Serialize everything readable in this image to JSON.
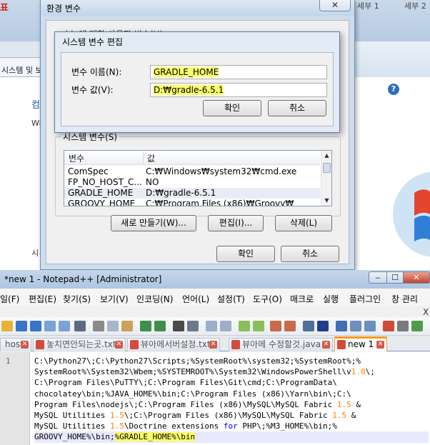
{
  "background": {
    "brand_fragment": "표",
    "tab_fragments": [
      "세부 1",
      "세부 2"
    ],
    "address_fragment": "시스템 및 보",
    "heading_fragment": "컴",
    "text_fragment": "Wi",
    "label_fragment": "시",
    "help_icon": "?"
  },
  "env_dialog": {
    "title": "환경 변수",
    "close_glyph": "✕",
    "user_group_label": "chip에 대한 사용자 변수(U)",
    "system_group_label": "시스템 변수(S)",
    "table": {
      "columns": [
        "변수",
        "값"
      ],
      "rows": [
        {
          "name": "ComSpec",
          "value": "C:₩Windows₩system32₩cmd.exe"
        },
        {
          "name": "FP_NO_HOST_C...",
          "value": "NO"
        },
        {
          "name": "GRADLE_HOME",
          "value": "D:₩gradle-6.5.1"
        },
        {
          "name": "GROOVY_HOME",
          "value": "C:₩Program Files (x86)₩Groovy₩"
        }
      ],
      "scroll_up": "▲",
      "scroll_down": "▼"
    },
    "buttons": {
      "new": "새로 만들기(W)...",
      "edit": "편집(I)...",
      "delete": "삭제(L)",
      "ok": "확인",
      "cancel": "취소"
    }
  },
  "edit_dialog": {
    "title": "시스템 변수 편집",
    "name_label": "변수 이름(N):",
    "value_label": "변수 값(V):",
    "name_value": "GRADLE_HOME",
    "value_value": "D:₩gradle-6.5.1",
    "ok": "확인",
    "cancel": "취소"
  },
  "notepad": {
    "title": "*new 1 - Notepad++ [Administrator]",
    "window_buttons": {
      "min": "‒",
      "max": "☐",
      "close": "✕"
    },
    "menu": [
      "일(F)",
      "편집(E)",
      "찾기(S)",
      "보기(V)",
      "인코딩(N)",
      "언어(L)",
      "설정(T)",
      "도구(O)",
      "매크로",
      "실행",
      "플러그인",
      "창 관리"
    ],
    "menu_close": "X",
    "tabs": [
      {
        "label": "hosts",
        "active": false,
        "icon_color": "#3a8ee6"
      },
      {
        "label": "놓치면안되는곳.txt",
        "active": false,
        "icon_color": "#d64a3a"
      },
      {
        "label": "뷰아메서버설정.txt",
        "active": false,
        "icon_color": "#d64a3a"
      },
      {
        "label": "뷰아메 수정할것.java",
        "active": false,
        "icon_color": "#d64a3a"
      },
      {
        "label": "new 1",
        "active": true,
        "icon_color": "#d64a3a"
      }
    ],
    "tab_close": "✕",
    "line_number": "1",
    "code_lines": [
      "C:\\Python27\\;C:\\Python27\\Scripts;%SystemRoot%\\system32;%SystemRoot%;%",
      "SystemRoot%\\System32\\Wbem;%SYSTEMROOT%\\System32\\WindowsPowerShell\\v1.0\\;",
      "C:\\Program Files\\PuTTY\\;C:\\Program Files\\Git\\cmd;C:\\ProgramData\\",
      "chocolatey\\bin;%JAVA_HOME%\\bin;C:\\Program Files (x86)\\Yarn\\bin\\;C:\\",
      "Program Files\\nodejs\\;C:\\Program Files (x86)\\MySQL\\MySQL Fabric 1.5 &",
      "MySQL Utilities 1.5\\;C:\\Program Files (x86)\\MySQL\\MySQL Fabric 1.5 &",
      "MySQL Utilities 1.5\\Doctrine extensions for PHP\\;%M3_HOME%\\bin;%",
      "GROOVY_HOME%\\bin;%GRADLE_HOME%\\bin"
    ]
  },
  "colors": {
    "highlight": "#fbff6a",
    "active_tab_accent": "#f59b20",
    "link_blue": "#1e5aa8"
  }
}
